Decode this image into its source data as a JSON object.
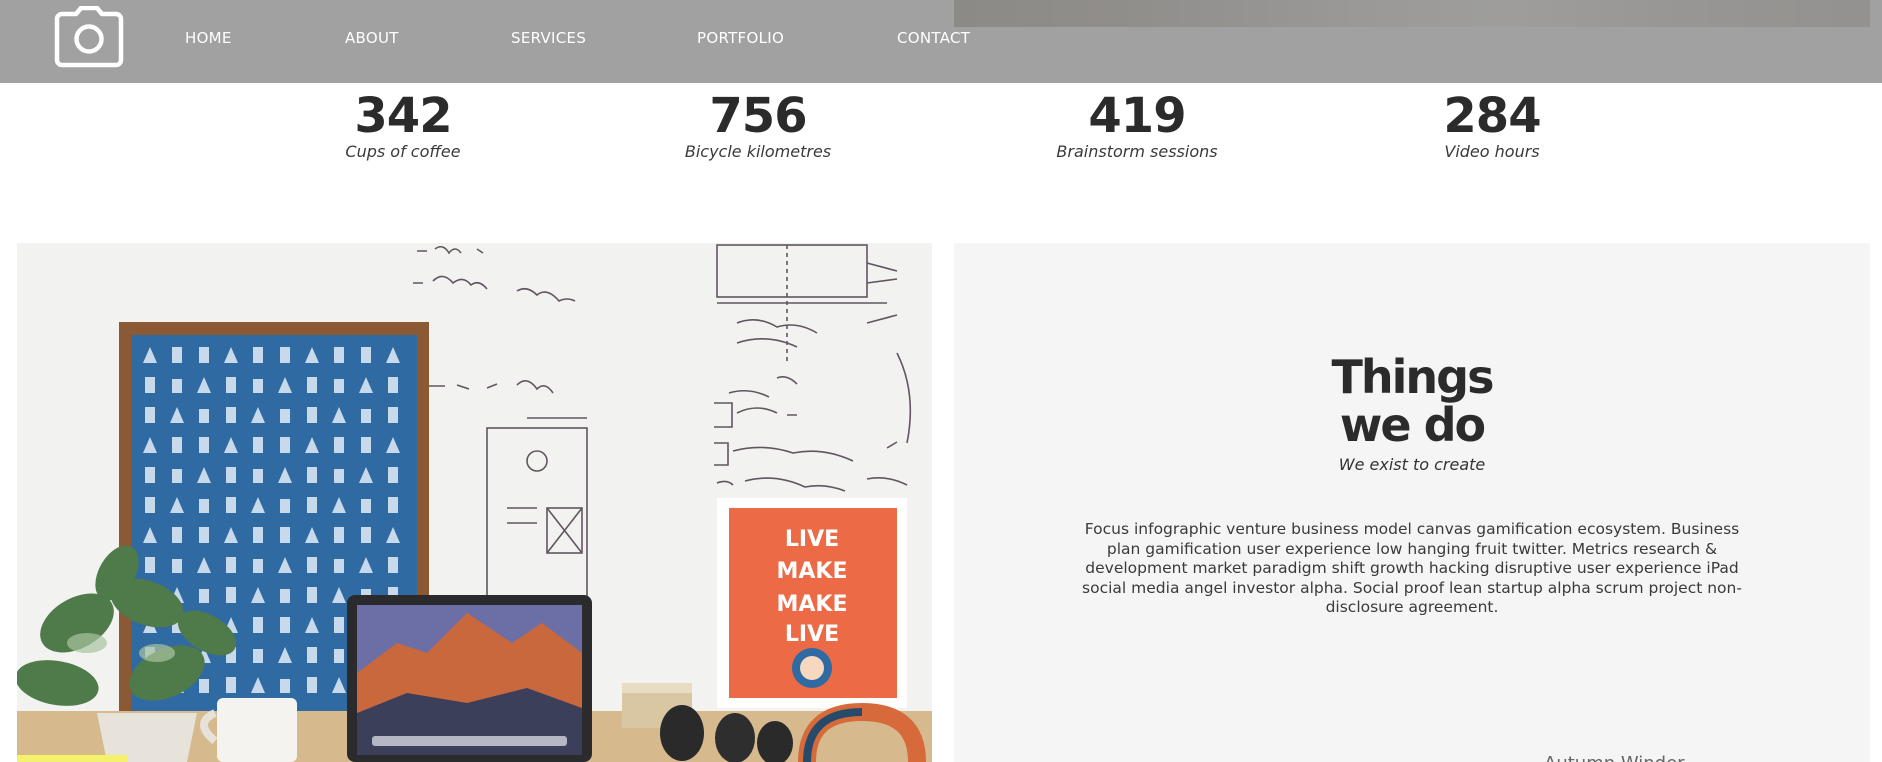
{
  "nav": {
    "logo_icon": "camera-icon",
    "items": [
      "HOME",
      "ABOUT",
      "SERVICES",
      "PORTFOLIO",
      "CONTACT"
    ]
  },
  "stats": [
    {
      "number": "342",
      "label": "Cups of coffee"
    },
    {
      "number": "756",
      "label": "Bicycle kilometres"
    },
    {
      "number": "419",
      "label": "Brainstorm sessions"
    },
    {
      "number": "284",
      "label": "Video hours"
    }
  ],
  "section": {
    "title_line1": "Things",
    "title_line2": "we do",
    "subtitle": "We exist to create",
    "body": "Focus infographic venture business model canvas gamification ecosystem. Business plan gamification user experience low hanging fruit twitter. Metrics research & development market paradigm shift growth hacking disruptive user experience iPad social media angel investor alpha. Social proof lean startup alpha scrum project non-disclosure agreement.",
    "footer_partial": "Autumn Winder"
  },
  "colors": {
    "navbar_overlay": "#8c8c8c",
    "text_dark": "#2b2b2b",
    "panel_bg": "#f5f5f5",
    "poster_blue": "#2f6aa3",
    "poster_orange": "#ec6a45"
  }
}
